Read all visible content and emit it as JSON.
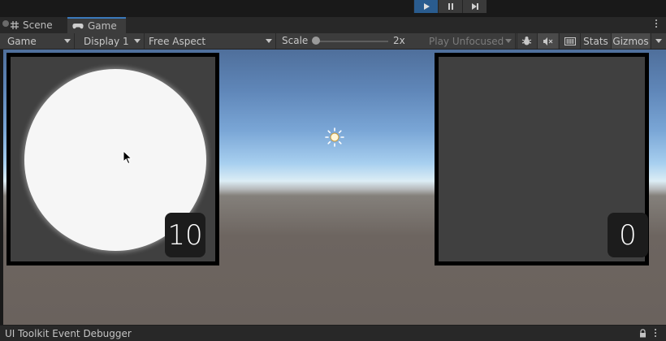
{
  "playbar": {
    "play_icon": "play-icon",
    "pause_icon": "pause-icon",
    "step_icon": "step-icon",
    "active_color": "#2a5c8f"
  },
  "tabs": [
    {
      "label": "Scene",
      "icon": "scene-grid-icon"
    },
    {
      "label": "Game",
      "icon": "gamepad-icon",
      "active": true
    }
  ],
  "toolbar": {
    "view_select": "Game",
    "display_select": "Display 1",
    "aspect_select": "Free Aspect",
    "scale_label": "Scale",
    "scale_value": "2x",
    "play_mode_select": "Play Unfocused",
    "bug_icon": "bug-icon",
    "mute_icon": "mute-icon",
    "stats_toggle_icon": "keyboard-icon",
    "stats_label": "Stats",
    "gizmos_label": "Gizmos"
  },
  "game": {
    "left_panel": {
      "counter": "10"
    },
    "right_panel": {
      "counter": "0"
    },
    "sun_icon": "sun-icon",
    "cursor_icon": "cursor-icon"
  },
  "bottom": {
    "title": "UI Toolkit Event Debugger",
    "lock_icon": "lock-icon"
  }
}
